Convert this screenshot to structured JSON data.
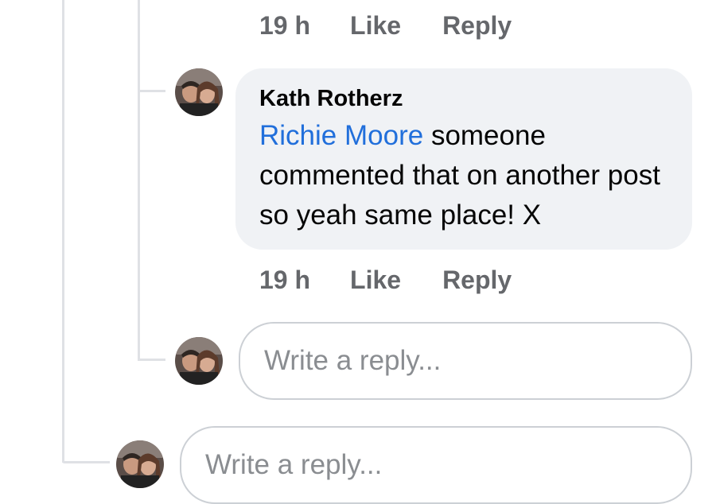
{
  "top_actions": {
    "time": "19 h",
    "like": "Like",
    "reply": "Reply"
  },
  "comment": {
    "author": "Kath Rotherz",
    "mention": "Richie Moore",
    "text_before": "someone",
    "text_rest": "commented that on another post so yeah same place! X",
    "time": "19 h",
    "like": "Like",
    "reply": "Reply",
    "avatar_icon": "user-avatar-couple"
  },
  "nested_reply_box": {
    "placeholder": "Write a reply..."
  },
  "outer_reply_box": {
    "placeholder": "Write a reply..."
  },
  "colors": {
    "mention_blue": "#216fdb",
    "bubble_bg": "#f0f2f5",
    "meta_gray": "#65676b",
    "placeholder_gray": "#8a8d91",
    "thread_line": "#dfe1e5"
  }
}
